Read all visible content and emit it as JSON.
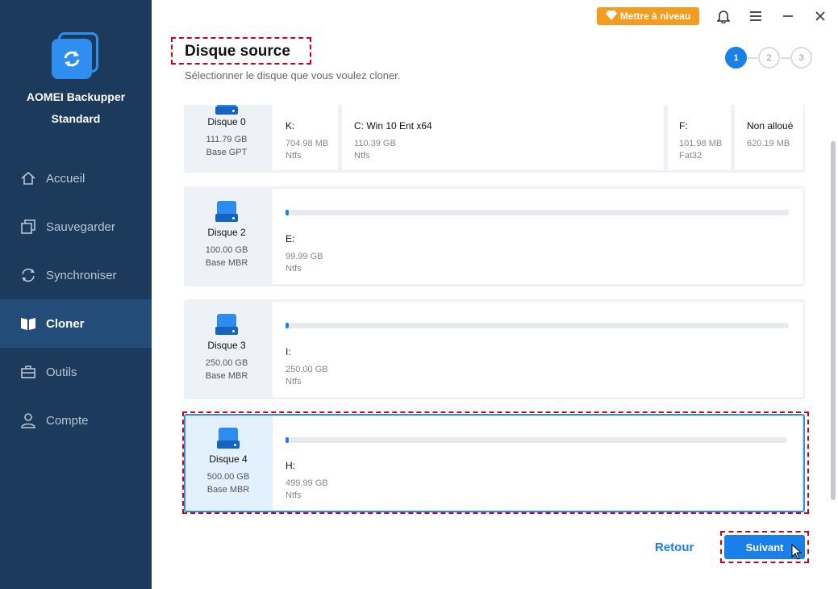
{
  "app": {
    "name": "AOMEI Backupper",
    "edition": "Standard"
  },
  "topbar": {
    "upgrade_label": "Mettre à niveau"
  },
  "nav": [
    {
      "label": "Accueil",
      "icon": "home-icon",
      "active": false
    },
    {
      "label": "Sauvegarder",
      "icon": "backup-icon",
      "active": false
    },
    {
      "label": "Synchroniser",
      "icon": "sync-icon",
      "active": false
    },
    {
      "label": "Cloner",
      "icon": "clone-icon",
      "active": true
    },
    {
      "label": "Outils",
      "icon": "tools-icon",
      "active": false
    },
    {
      "label": "Compte",
      "icon": "user-icon",
      "active": false
    }
  ],
  "header": {
    "title": "Disque source",
    "subtitle": "Sélectionner le disque que vous voulez cloner."
  },
  "steps": [
    "1",
    "2",
    "3"
  ],
  "disks": [
    {
      "name": "Disque 0",
      "size": "111.79 GB",
      "type": "Base GPT",
      "partitions": [
        {
          "label": "K:",
          "size": "704.98 MB",
          "fs": "Ntfs"
        },
        {
          "label": "C: Win 10 Ent x64",
          "size": "110.39 GB",
          "fs": "Ntfs"
        },
        {
          "label": "F:",
          "size": "101.98 MB",
          "fs": "Fat32"
        },
        {
          "label": "Non alloué",
          "size": "620.19 MB",
          "fs": ""
        }
      ]
    },
    {
      "name": "Disque 2",
      "size": "100.00 GB",
      "type": "Base MBR",
      "partitions": [
        {
          "label": "E:",
          "size": "99.99 GB",
          "fs": "Ntfs"
        }
      ]
    },
    {
      "name": "Disque 3",
      "size": "250.00 GB",
      "type": "Base MBR",
      "partitions": [
        {
          "label": "I:",
          "size": "250.00 GB",
          "fs": "Ntfs"
        }
      ]
    },
    {
      "name": "Disque 4",
      "size": "500.00 GB",
      "type": "Base MBR",
      "selected": true,
      "partitions": [
        {
          "label": "H:",
          "size": "499.99 GB",
          "fs": "Ntfs"
        }
      ]
    }
  ],
  "footer": {
    "back_label": "Retour",
    "next_label": "Suivant"
  },
  "colors": {
    "sidebar": "#1b3a5c",
    "accent": "#1a7fe8",
    "upgrade": "#f39c1f",
    "highlight": "#d0021b"
  }
}
